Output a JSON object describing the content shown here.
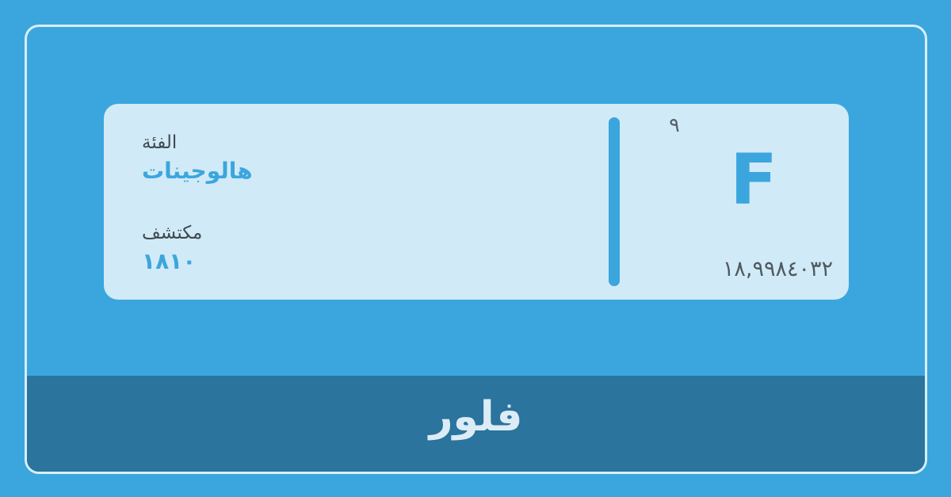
{
  "element": {
    "atomic_number": "٩",
    "symbol": "F",
    "atomic_mass": "١٨,٩٩٨٤٠٣٢",
    "name": "فلور"
  },
  "info": {
    "category_label": "الفئة",
    "category_value": "هالوجينات",
    "discovery_label": "مكتشف",
    "discovery_value": "١٨١٠"
  },
  "colors": {
    "background": "#3ba6dd",
    "card": "#d1eaf7",
    "footer": "#2a749d",
    "accent": "#3ba6dd"
  }
}
